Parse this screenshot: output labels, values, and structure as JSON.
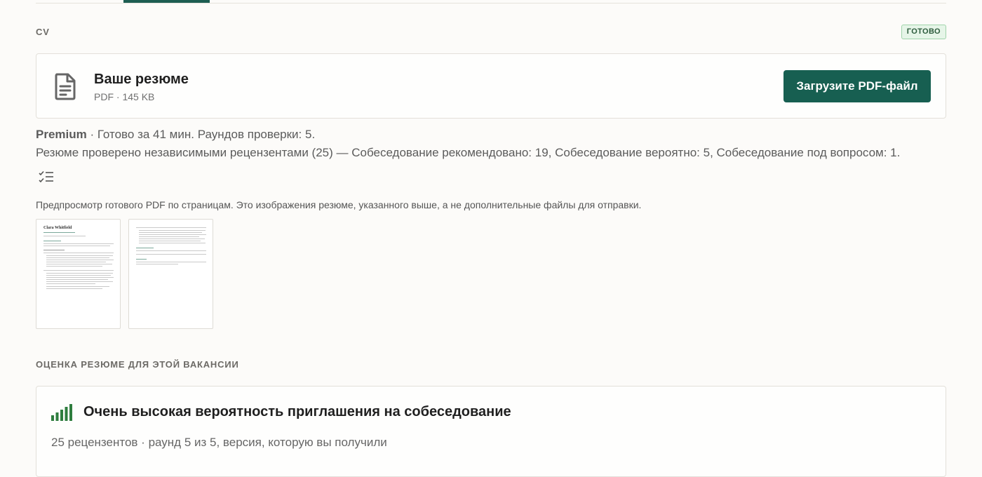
{
  "section_cv": {
    "label": "CV",
    "status": "ГОТОВО"
  },
  "file": {
    "title": "Ваше резюме",
    "meta": "PDF · 145 KB",
    "upload_button": "Загрузите PDF-файл",
    "icon": "document-icon"
  },
  "summary": {
    "tier": "Premium",
    "line1_rest": " · Готово за 41 мин. Раундов проверки: 5.",
    "line2": "Резюме проверено независимыми рецензентами (25) — Собеседование рекомендовано: 19, Собеседование вероятно: 5, Собеседование под вопросом: 1.",
    "checklist_icon": "checklist-icon"
  },
  "preview": {
    "note": "Предпросмотр готового PDF по страницам. Это изображения резюме, указанного выше, а не дополнительные файлы для отправки.",
    "pages": [
      {
        "name": "Clara Whitfield"
      },
      {
        "name": ""
      }
    ]
  },
  "section_score": {
    "label": "ОЦЕНКА РЕЗЮМЕ ДЛЯ ЭТОЙ ВАКАНСИИ"
  },
  "score": {
    "title": "Очень высокая вероятность приглашения на собеседование",
    "subtitle": "25 рецензентов · раунд 5 из 5, версия, которую вы получили",
    "icon": "signal-bars-icon",
    "accent_color": "#2e7d3e",
    "level_bars": 5
  },
  "colors": {
    "brand": "#175f51",
    "badge_bg": "#e6f5e8",
    "badge_text": "#2c5b3c"
  }
}
